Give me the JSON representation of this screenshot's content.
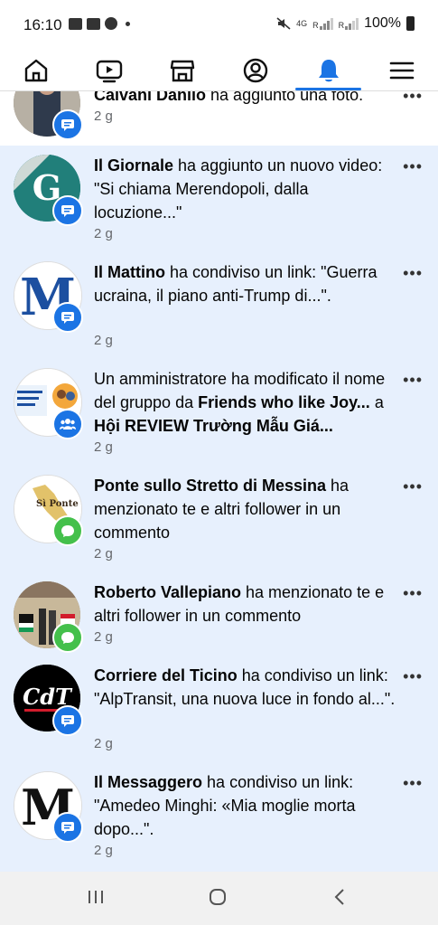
{
  "status_bar": {
    "time": "16:10",
    "network": "4G",
    "sim_r1": "R",
    "sim_r2": "R",
    "battery": "100%"
  },
  "nav": {
    "items": [
      "home-icon",
      "video-icon",
      "marketplace-icon",
      "profile-icon",
      "notifications-icon",
      "menu-icon"
    ],
    "active": "notifications-icon",
    "accent": "#1b74e4"
  },
  "notifications": [
    {
      "actor": "Calvani Danilo",
      "action": " ha aggiunto una foto.",
      "time": "2 g",
      "badge": "comment-icon"
    },
    {
      "actor": "Il Giornale",
      "action": " ha aggiunto un nuovo video: \"Si chiama Merendopoli, dalla locuzione...\"",
      "time": "2 g",
      "badge": "comment-icon",
      "avatar_letter": "G"
    },
    {
      "actor": "Il Mattino",
      "action": " ha condiviso un link: \"Guerra ucraina, il piano anti-Trump di...\".",
      "time": "2 g",
      "badge": "comment-icon",
      "avatar_letter": "M"
    },
    {
      "prefix": "Un amministratore ha modificato il nome del gruppo da ",
      "actor": "Friends who like Joy...",
      "mid": " a ",
      "actor2": "Hội REVIEW Trường Mẫu Giá...",
      "time": "2 g",
      "badge": "group-icon"
    },
    {
      "actor": "Ponte sullo Stretto di Messina",
      "action": " ha menzionato te e altri follower in un commento",
      "time": "2 g",
      "badge": "message-icon",
      "avatar_letter": "Sì Ponte"
    },
    {
      "actor": "Roberto Vallepiano",
      "action": " ha menzionato te e altri follower in un commento",
      "time": "2 g",
      "badge": "message-icon"
    },
    {
      "actor": "Corriere del Ticino",
      "action": " ha condiviso un link: \"AlpTransit, una nuova luce in fondo al...\".",
      "time": "2 g",
      "badge": "comment-icon",
      "avatar_letter": "CdT"
    },
    {
      "actor": "Il Messaggero",
      "action": " ha condiviso un link: \"Amedeo Minghi: «Mia moglie morta dopo...\".",
      "time": "2 g",
      "badge": "comment-icon",
      "avatar_letter": "M"
    }
  ],
  "more_label": "•••"
}
